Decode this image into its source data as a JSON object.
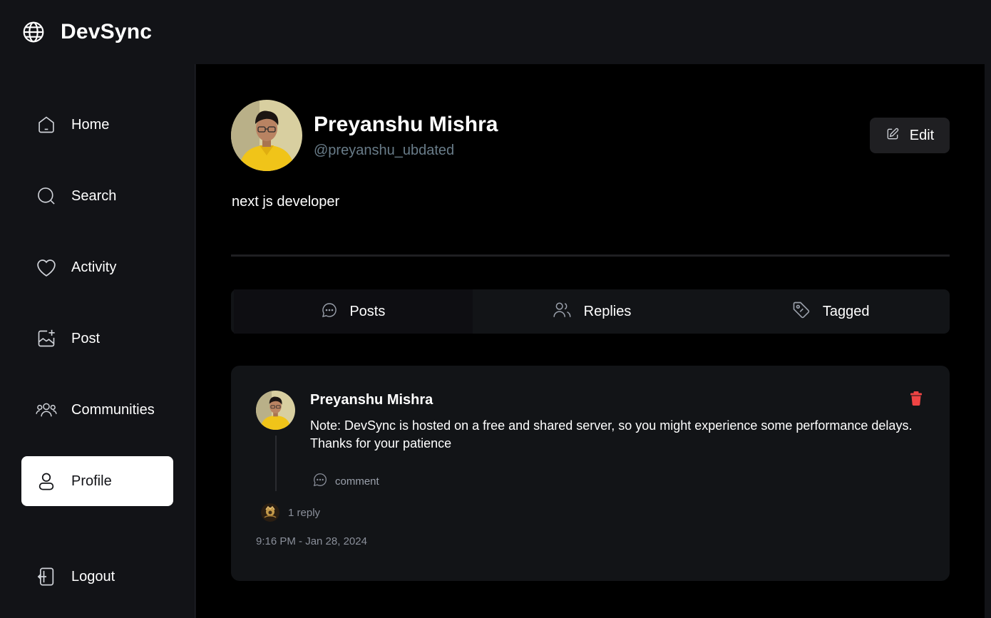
{
  "app": {
    "name": "DevSync"
  },
  "sidebar": {
    "items": [
      {
        "label": "Home",
        "icon": "home-icon"
      },
      {
        "label": "Search",
        "icon": "search-icon"
      },
      {
        "label": "Activity",
        "icon": "heart-icon"
      },
      {
        "label": "Post",
        "icon": "image-plus-icon"
      },
      {
        "label": "Communities",
        "icon": "users-icon"
      },
      {
        "label": "Profile",
        "icon": "user-icon",
        "active": true
      }
    ],
    "logout_label": "Logout"
  },
  "profile": {
    "name": "Preyanshu Mishra",
    "handle": "@preyanshu_ubdated",
    "bio": "next js developer",
    "edit_label": "Edit"
  },
  "tabs": [
    {
      "label": "Posts",
      "icon": "chat-bubble-icon",
      "active": true
    },
    {
      "label": "Replies",
      "icon": "people-icon"
    },
    {
      "label": "Tagged",
      "icon": "tag-icon"
    }
  ],
  "post": {
    "author": "Preyanshu Mishra",
    "text": "Note: DevSync is hosted on a free and shared server, so you might experience some performance delays. Thanks for your patience",
    "comment_label": "comment",
    "reply_count": "1 reply",
    "timestamp": "9:16 PM - Jan 28, 2024"
  },
  "colors": {
    "background": "#121317",
    "main_background": "#000000",
    "card": "#121417",
    "handle": "#697c89",
    "delete": "#ef4444",
    "active_nav": "#ffffff"
  }
}
